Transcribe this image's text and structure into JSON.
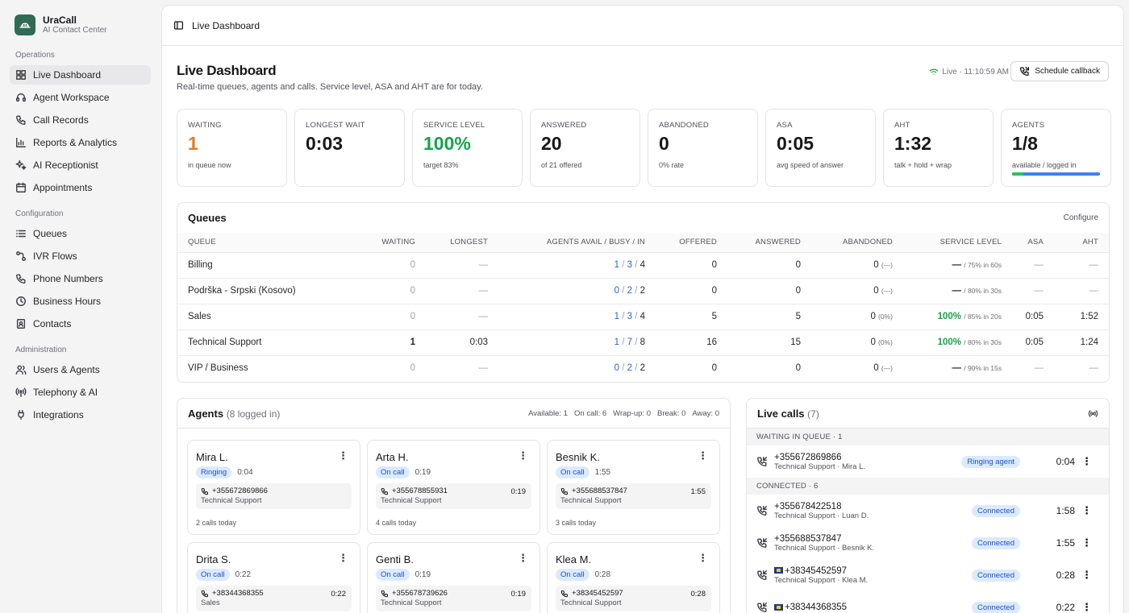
{
  "brand": {
    "title": "UraCall",
    "subtitle": "AI Contact Center"
  },
  "nav": {
    "sections": {
      "operations": "Operations",
      "configuration": "Configuration",
      "administration": "Administration"
    },
    "items": [
      {
        "label": "Live Dashboard",
        "icon": "grid-icon"
      },
      {
        "label": "Agent Workspace",
        "icon": "headset-icon"
      },
      {
        "label": "Call Records",
        "icon": "phone-icon"
      },
      {
        "label": "Reports & Analytics",
        "icon": "bar-chart-icon"
      },
      {
        "label": "AI Receptionist",
        "icon": "sparkles-icon"
      },
      {
        "label": "Appointments",
        "icon": "calendar-icon"
      },
      {
        "label": "Queues",
        "icon": "list-icon"
      },
      {
        "label": "IVR Flows",
        "icon": "flow-icon"
      },
      {
        "label": "Phone Numbers",
        "icon": "phone-icon"
      },
      {
        "label": "Business Hours",
        "icon": "clock-icon"
      },
      {
        "label": "Contacts",
        "icon": "contact-icon"
      },
      {
        "label": "Users & Agents",
        "icon": "users-icon"
      },
      {
        "label": "Telephony & AI",
        "icon": "antenna-icon"
      },
      {
        "label": "Integrations",
        "icon": "plug-icon"
      }
    ]
  },
  "topbar": {
    "breadcrumb": "Live Dashboard"
  },
  "header": {
    "title": "Live Dashboard",
    "subtitle": "Real-time queues, agents and calls. Service level, ASA and AHT are for today.",
    "live": "Live · 11:10:59 AM",
    "schedule_button": "Schedule callback"
  },
  "kpis": [
    {
      "label": "WAITING",
      "value": "1",
      "note": "in queue now",
      "color": "#ea7a1c"
    },
    {
      "label": "LONGEST WAIT",
      "value": "0:03",
      "note": "",
      "color": "#18181b"
    },
    {
      "label": "SERVICE LEVEL",
      "value": "100%",
      "note": "target 83%",
      "color": "#16a34a"
    },
    {
      "label": "ANSWERED",
      "value": "20",
      "note": "of 21 offered",
      "color": "#18181b"
    },
    {
      "label": "ABANDONED",
      "value": "0",
      "note": "0% rate",
      "color": "#18181b"
    },
    {
      "label": "ASA",
      "value": "0:05",
      "note": "avg speed of answer",
      "color": "#18181b"
    },
    {
      "label": "AHT",
      "value": "1:32",
      "note": "talk + hold + wrap",
      "color": "#18181b"
    },
    {
      "label": "AGENTS",
      "value": "1/8",
      "note": "available / logged in",
      "color": "#18181b",
      "progress": 0.125
    }
  ],
  "queues": {
    "title": "Queues",
    "configure": "Configure",
    "columns": [
      "QUEUE",
      "WAITING",
      "LONGEST",
      "AGENTS AVAIL / BUSY / IN",
      "OFFERED",
      "ANSWERED",
      "ABANDONED",
      "SERVICE LEVEL",
      "ASA",
      "AHT"
    ],
    "rows": [
      {
        "name": "Billing",
        "waiting": "0",
        "longest": "—",
        "avail": "1",
        "busy": "3",
        "in": "4",
        "offered": "0",
        "answered": "0",
        "abandoned": "0",
        "abandoned_pct": "(—)",
        "sl": "—",
        "sl_target": "/ 75% in 60s",
        "asa": "—",
        "aht": "—"
      },
      {
        "name": "Podrška - Srpski (Kosovo)",
        "waiting": "0",
        "longest": "—",
        "avail": "0",
        "busy": "2",
        "in": "2",
        "offered": "0",
        "answered": "0",
        "abandoned": "0",
        "abandoned_pct": "(—)",
        "sl": "—",
        "sl_target": "/ 80% in 30s",
        "asa": "—",
        "aht": "—"
      },
      {
        "name": "Sales",
        "waiting": "0",
        "longest": "—",
        "avail": "1",
        "busy": "3",
        "in": "4",
        "offered": "5",
        "answered": "5",
        "abandoned": "0",
        "abandoned_pct": "(0%)",
        "sl": "100%",
        "sl_target": "/ 85% in 20s",
        "asa": "0:05",
        "aht": "1:52"
      },
      {
        "name": "Technical Support",
        "waiting": "1",
        "longest": "0:03",
        "avail": "1",
        "busy": "7",
        "in": "8",
        "offered": "16",
        "answered": "15",
        "abandoned": "0",
        "abandoned_pct": "(0%)",
        "sl": "100%",
        "sl_target": "/ 80% in 30s",
        "asa": "0:05",
        "aht": "1:24"
      },
      {
        "name": "VIP / Business",
        "waiting": "0",
        "longest": "—",
        "avail": "0",
        "busy": "2",
        "in": "2",
        "offered": "0",
        "answered": "0",
        "abandoned": "0",
        "abandoned_pct": "(—)",
        "sl": "—",
        "sl_target": "/ 90% in 15s",
        "asa": "—",
        "aht": "—"
      }
    ]
  },
  "agents": {
    "title": "Agents",
    "count": "(8 logged in)",
    "stats": [
      "Available: 1",
      "On call: 6",
      "Wrap-up: 0",
      "Break: 0",
      "Away: 0"
    ],
    "cards": [
      {
        "name": "Mira L.",
        "status": "Ringing",
        "timer": "0:04",
        "number": "+355672869866",
        "queue": "Technical Support",
        "call_time": "",
        "today": "2 calls today"
      },
      {
        "name": "Arta H.",
        "status": "On call",
        "timer": "0:19",
        "number": "+355678855931",
        "queue": "Technical Support",
        "call_time": "0:19",
        "today": "4 calls today"
      },
      {
        "name": "Besnik K.",
        "status": "On call",
        "timer": "1:55",
        "number": "+355688537847",
        "queue": "Technical Support",
        "call_time": "1:55",
        "today": "3 calls today"
      },
      {
        "name": "Drita S.",
        "status": "On call",
        "timer": "0:22",
        "number": "+38344368355",
        "queue": "Sales",
        "call_time": "0:22",
        "today": ""
      },
      {
        "name": "Genti B.",
        "status": "On call",
        "timer": "0:19",
        "number": "+355678739626",
        "queue": "Technical Support",
        "call_time": "0:19",
        "today": ""
      },
      {
        "name": "Klea M.",
        "status": "On call",
        "timer": "0:28",
        "number": "+38345452597",
        "queue": "Technical Support",
        "call_time": "0:28",
        "today": ""
      }
    ]
  },
  "live_calls": {
    "title": "Live calls",
    "count": "(7)",
    "waiting_label": "WAITING IN QUEUE · 1",
    "connected_label": "CONNECTED · 6",
    "waiting": [
      {
        "number": "+355672869866",
        "detail": "Technical Support · Mira L.",
        "badge": "Ringing agent",
        "time": "0:04",
        "flag": false
      }
    ],
    "connected": [
      {
        "number": "+355678422518",
        "detail": "Technical Support · Luan D.",
        "badge": "Connected",
        "time": "1:58",
        "flag": false
      },
      {
        "number": "+355688537847",
        "detail": "Technical Support · Besnik K.",
        "badge": "Connected",
        "time": "1:55",
        "flag": false
      },
      {
        "number": "+38345452597",
        "detail": "Technical Support · Klea M.",
        "badge": "Connected",
        "time": "0:28",
        "flag": true
      },
      {
        "number": "+38344368355",
        "detail": "",
        "badge": "Connected",
        "time": "0:22",
        "flag": true
      }
    ]
  }
}
